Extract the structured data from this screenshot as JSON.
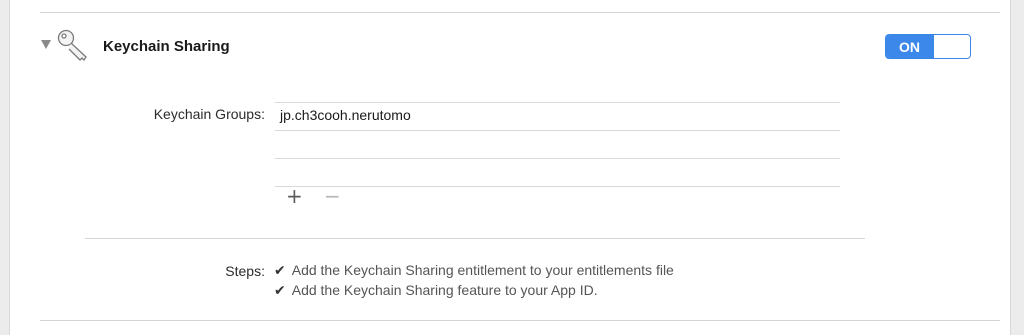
{
  "capability": {
    "title": "Keychain Sharing",
    "icon": "key-icon",
    "toggle_label": "ON",
    "toggle_state": "on"
  },
  "groups": {
    "label": "Keychain Groups:",
    "items": [
      "jp.ch3cooh.nerutomo"
    ],
    "add_label": "+",
    "remove_label": "−"
  },
  "steps": {
    "label": "Steps:",
    "items": [
      {
        "check": "✔",
        "text": "Add the Keychain Sharing entitlement to your entitlements file"
      },
      {
        "check": "✔",
        "text": "Add the Keychain Sharing feature to your App ID."
      }
    ]
  },
  "colors": {
    "accent": "#3b88ea",
    "background": "#ececec",
    "panel": "#ffffff"
  }
}
